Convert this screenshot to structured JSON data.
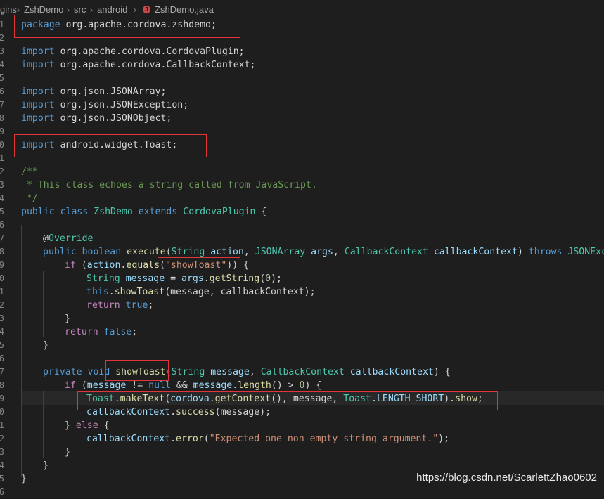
{
  "breadcrumb": {
    "items": [
      "gins",
      "ZshDemo",
      "src",
      "android",
      "ZshDemo.java"
    ],
    "java_icon": "J"
  },
  "line_numbers": [
    "1",
    "2",
    "3",
    "4",
    "5",
    "6",
    "7",
    "8",
    "9",
    "10",
    "11",
    "12",
    "13",
    "14",
    "15",
    "16",
    "17",
    "18",
    "19",
    "20",
    "21",
    "22",
    "23",
    "24",
    "25",
    "26",
    "27",
    "28",
    "29",
    "30",
    "31",
    "32",
    "33",
    "34",
    "35",
    "36"
  ],
  "code": {
    "l1_package": "package",
    "l1_name": " org.apache.cordova.zshdemo;",
    "l3_import": "import",
    "l3_name": " org.apache.cordova.CordovaPlugin;",
    "l4_import": "import",
    "l4_name": " org.apache.cordova.CallbackContext;",
    "l6_import": "import",
    "l6_name": " org.json.JSONArray;",
    "l7_import": "import",
    "l7_name": " org.json.JSONException;",
    "l8_import": "import",
    "l8_name": " org.json.JSONObject;",
    "l10_import": "import",
    "l10_name": " android.widget.Toast;",
    "l12": "/**",
    "l13": " * This class echoes a string called from JavaScript.",
    "l14": " */",
    "l15_public": "public",
    "l15_class": " class ",
    "l15_name": "ZshDemo",
    "l15_extends": " extends ",
    "l15_parent": "CordovaPlugin",
    "l15_brace": " {",
    "l17_at": "@",
    "l17_override": "Override",
    "l18_public": "public",
    "l18_boolean": " boolean ",
    "l18_execute": "execute",
    "l18_p1": "(",
    "l18_string": "String",
    "l18_action": " action",
    "l18_c1": ", ",
    "l18_jsonarray": "JSONArray",
    "l18_args": " args",
    "l18_c2": ", ",
    "l18_cbctx": "CallbackContext",
    "l18_cbvar": " callbackContext",
    "l18_p2": ") ",
    "l18_throws": "throws",
    "l18_jsonexc": " JSONExcept",
    "l19_if": "if",
    "l19_open": " (",
    "l19_action": "action",
    "l19_dot": ".",
    "l19_equals": "equals",
    "l19_p": "(",
    "l19_str": "\"showToast\"",
    "l19_close": ")) {",
    "l20_string": "String",
    "l20_message": " message",
    "l20_eq": " = ",
    "l20_args": "args",
    "l20_dot": ".",
    "l20_getstring": "getString",
    "l20_p": "(",
    "l20_zero": "0",
    "l20_end": ");",
    "l21_this": "this",
    "l21_dot": ".",
    "l21_showtoast": "showToast",
    "l21_rest": "(message, callbackContext);",
    "l22_return": "return",
    "l22_true": " true",
    "l22_end": ";",
    "l23": "}",
    "l24_return": "return",
    "l24_false": " false",
    "l24_end": ";",
    "l25": "}",
    "l27_private": "private",
    "l27_void": " void ",
    "l27_showtoast": "showToast",
    "l27_p": "(",
    "l27_string": "String",
    "l27_message": " message",
    "l27_c": ", ",
    "l27_cbctx": "CallbackContext",
    "l27_cbvar": " callbackContext",
    "l27_end": ") {",
    "l28_if": "if",
    "l28_open": " (",
    "l28_message": "message",
    "l28_ne": " != ",
    "l28_null": "null",
    "l28_and": " && ",
    "l28_message2": "message",
    "l28_dot": ".",
    "l28_length": "length",
    "l28_gt": "() > ",
    "l28_zero": "0",
    "l28_end": ") {",
    "l29_toast": "Toast",
    "l29_dot": ".",
    "l29_maketext": "makeText",
    "l29_p": "(",
    "l29_cordova": "cordova",
    "l29_dot2": ".",
    "l29_getcontext": "getContext",
    "l29_mid": "(), message, ",
    "l29_toast2": "Toast",
    "l29_dot3": ".",
    "l29_length": "LENGTH_SHORT",
    "l29_close": ").",
    "l29_show": "show",
    "l29_end": ";",
    "l30_cb": "callbackContext",
    "l30_dot": ".",
    "l30_success": "success",
    "l30_rest": "(message);",
    "l31_brace": "} ",
    "l31_else": "else",
    "l31_end": " {",
    "l32_cb": "callbackContext",
    "l32_dot": ".",
    "l32_error": "error",
    "l32_p": "(",
    "l32_str": "\"Expected one non-empty string argument.\"",
    "l32_end": ");",
    "l33": "}",
    "l34": "}",
    "l35": "}"
  },
  "watermark": "https://blog.csdn.net/ScarlettZhao0602",
  "colors": {
    "background": "#1e1e1e",
    "keyword": "#569cd6",
    "control": "#c586c0",
    "type": "#4ec9b0",
    "function": "#dcdcaa",
    "variable": "#9cdcfe",
    "string": "#ce9178",
    "comment": "#6a9955",
    "highlight_box": "#e0353b"
  }
}
